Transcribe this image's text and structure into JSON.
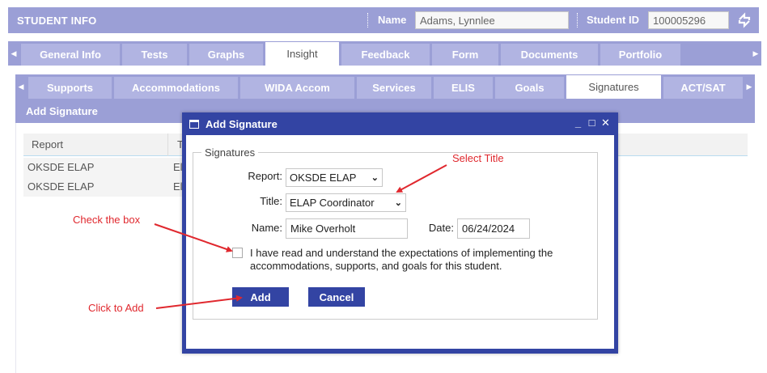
{
  "header": {
    "title": "STUDENT INFO",
    "name_label": "Name",
    "name_value": "Adams, Lynnlee",
    "id_label": "Student ID",
    "id_value": "100005296",
    "sync_icon": "sync-arrows-icon"
  },
  "main_tabs": [
    {
      "label": "General Info",
      "active": false
    },
    {
      "label": "Tests",
      "active": false
    },
    {
      "label": "Graphs",
      "active": false
    },
    {
      "label": "Insight",
      "active": true
    },
    {
      "label": "Feedback",
      "active": false
    },
    {
      "label": "Form",
      "active": false
    },
    {
      "label": "Documents",
      "active": false
    },
    {
      "label": "Portfolio",
      "active": false
    }
  ],
  "sub_tabs": [
    {
      "label": "Supports",
      "active": false
    },
    {
      "label": "Accommodations",
      "active": false
    },
    {
      "label": "WIDA Accom",
      "active": false
    },
    {
      "label": "Services",
      "active": false
    },
    {
      "label": "ELIS",
      "active": false
    },
    {
      "label": "Goals",
      "active": false
    },
    {
      "label": "Signatures",
      "active": true
    },
    {
      "label": "ACT/SAT",
      "active": false
    }
  ],
  "panel": {
    "title": "Add Signature",
    "columns": [
      "Report",
      "T"
    ],
    "rows": [
      {
        "report": "OKSDE ELAP",
        "title": "El"
      },
      {
        "report": "OKSDE ELAP",
        "title": "El"
      }
    ]
  },
  "modal": {
    "title": "Add Signature",
    "controls": {
      "minimize": "_",
      "maximize": "□",
      "close": "✕"
    },
    "legend": "Signatures",
    "report_label": "Report:",
    "report_value": "OKSDE ELAP",
    "title_label": "Title:",
    "title_value": "ELAP Coordinator",
    "name_label": "Name:",
    "name_value": "Mike Overholt",
    "date_label": "Date:",
    "date_value": "06/24/2024",
    "agree_line1": "I have read and understand the expectations of implementing the",
    "agree_line2": "accommodations, supports, and goals for this student.",
    "agree_checked": false,
    "add_label": "Add",
    "cancel_label": "Cancel"
  },
  "annotations": {
    "select_title": "Select Title",
    "check_box": "Check the box",
    "click_add": "Click to Add",
    "color": "#e0282e"
  },
  "colors": {
    "header_bg": "#9b9fd6",
    "tab_bg": "#b1b4e2",
    "modal_bg": "#3344a3",
    "button_bg": "#3344a3"
  }
}
